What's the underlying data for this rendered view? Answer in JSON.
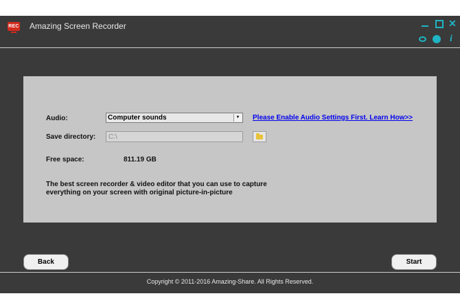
{
  "window": {
    "logo_text": "REC",
    "title": "Amazing Screen Recorder",
    "controls": {
      "minimize_icon": "minimize-icon",
      "maximize_icon": "maximize-icon",
      "close_icon": "close-icon",
      "close_glyph": "✕"
    },
    "tools": {
      "chat_icon": "chat-icon",
      "globe_icon": "globe-icon",
      "info_glyph": "i"
    }
  },
  "settings": {
    "audio_label": "Audio:",
    "audio_selected": "Computer sounds",
    "audio_link": "Please Enable Audio Settings First. Learn How>>",
    "save_dir_label": "Save directory:",
    "save_dir_value": "C:\\",
    "free_space_label": "Free space:",
    "free_space_value": "811.19 GB",
    "description_line1": "The best screen recorder & video editor that you can use to capture",
    "description_line2": "everything on your screen with original picture-in-picture"
  },
  "actions": {
    "back_label": "Back",
    "start_label": "Start"
  },
  "footer": {
    "copyright": "Copyright © 2011-2016 Amazing-Share. All Rights Reserved."
  },
  "colors": {
    "app_bg": "#3a3a3a",
    "panel_bg": "#c6c6c6",
    "accent": "#1fb3c4",
    "logo_red": "#d42a1e",
    "link": "#0000ee"
  }
}
